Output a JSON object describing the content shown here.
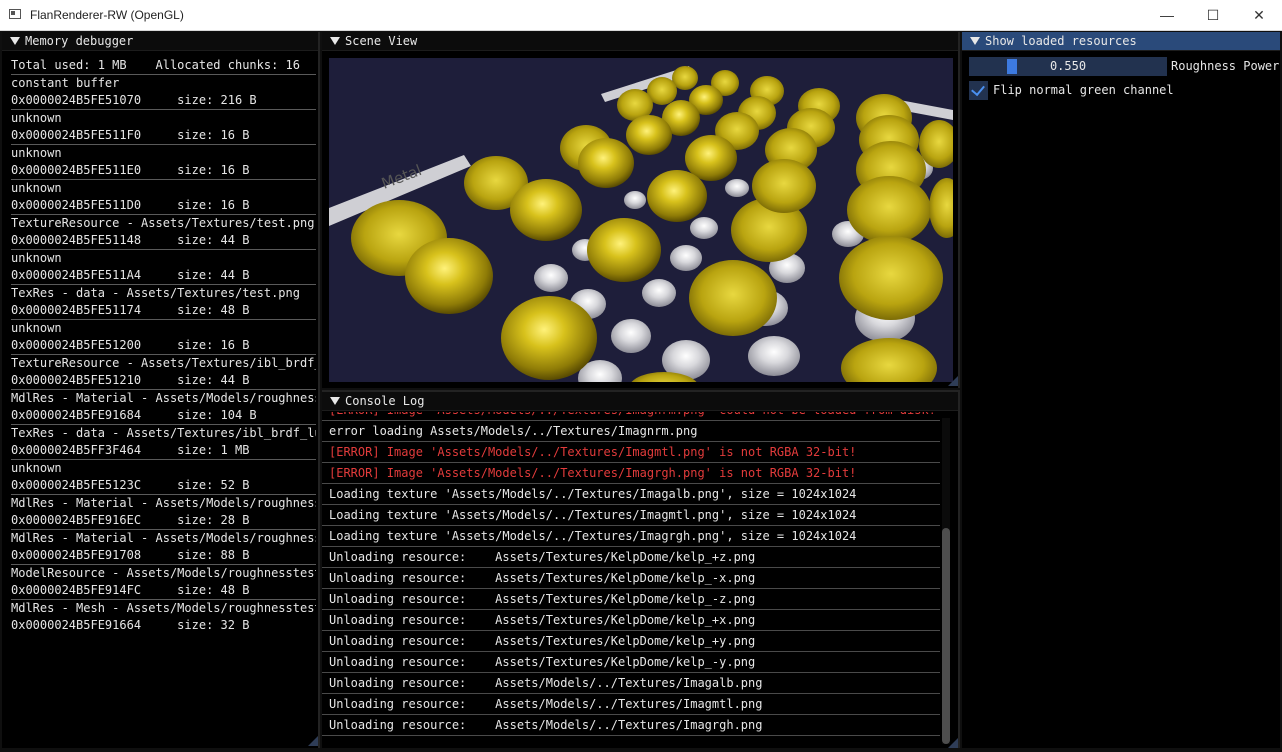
{
  "window": {
    "title": "FlanRenderer-RW (OpenGL)",
    "minimize_glyph": "—",
    "maximize_glyph": "☐",
    "close_glyph": "✕"
  },
  "memory_debugger": {
    "title": "Memory debugger",
    "total": "Total used: 1 MB    Allocated chunks: 16",
    "entries": [
      {
        "name": "constant buffer",
        "detail": "0x0000024B5FE51070     size: 216 B"
      },
      {
        "name": "unknown",
        "detail": "0x0000024B5FE511F0     size: 16 B"
      },
      {
        "name": "unknown",
        "detail": "0x0000024B5FE511E0     size: 16 B"
      },
      {
        "name": "unknown",
        "detail": "0x0000024B5FE511D0     size: 16 B"
      },
      {
        "name": "TextureResource - Assets/Textures/test.png",
        "detail": "0x0000024B5FE51148     size: 44 B"
      },
      {
        "name": "unknown",
        "detail": "0x0000024B5FE511A4     size: 44 B"
      },
      {
        "name": "TexRes - data - Assets/Textures/test.png",
        "detail": "0x0000024B5FE51174     size: 48 B"
      },
      {
        "name": "unknown",
        "detail": "0x0000024B5FE51200     size: 16 B"
      },
      {
        "name": "TextureResource - Assets/Textures/ibl_brdf_",
        "detail": "0x0000024B5FE51210     size: 44 B"
      },
      {
        "name": "MdlRes - Material - Assets/Models/roughness",
        "detail": "0x0000024B5FE91684     size: 104 B"
      },
      {
        "name": "TexRes - data - Assets/Textures/ibl_brdf_lu",
        "detail": "0x0000024B5FF3F464     size: 1 MB"
      },
      {
        "name": "unknown",
        "detail": "0x0000024B5FE5123C     size: 52 B"
      },
      {
        "name": "MdlRes - Material - Assets/Models/roughness",
        "detail": "0x0000024B5FE916EC     size: 28 B"
      },
      {
        "name": "MdlRes - Material - Assets/Models/roughness",
        "detail": "0x0000024B5FE91708     size: 88 B"
      },
      {
        "name": "ModelResource - Assets/Models/roughnesstest.",
        "detail": "0x0000024B5FE914FC     size: 48 B"
      },
      {
        "name": "MdlRes - Mesh - Assets/Models/roughnesstest.",
        "detail": "0x0000024B5FE91664     size: 32 B"
      }
    ]
  },
  "scene_view": {
    "title": "Scene View",
    "sign_label": "Metal",
    "background_color": "#1e1e3a",
    "gold_color": "#c9b516",
    "silver_color": "#d9d9dc"
  },
  "console_log": {
    "title": "Console Log",
    "lines": [
      {
        "text": "[ERROR] Image 'Assets/Models/../Textures/Imagnrm.png' could not be loaded from disk!",
        "error": true
      },
      {
        "text": "error loading Assets/Models/../Textures/Imagnrm.png",
        "error": false
      },
      {
        "text": "[ERROR] Image 'Assets/Models/../Textures/Imagmtl.png' is not RGBA 32-bit!",
        "error": true
      },
      {
        "text": "[ERROR] Image 'Assets/Models/../Textures/Imagrgh.png' is not RGBA 32-bit!",
        "error": true
      },
      {
        "text": "Loading texture 'Assets/Models/../Textures/Imagalb.png', size = 1024x1024",
        "error": false
      },
      {
        "text": "Loading texture 'Assets/Models/../Textures/Imagmtl.png', size = 1024x1024",
        "error": false
      },
      {
        "text": "Loading texture 'Assets/Models/../Textures/Imagrgh.png', size = 1024x1024",
        "error": false
      },
      {
        "text": "Unloading resource:    Assets/Textures/KelpDome/kelp_+z.png",
        "error": false
      },
      {
        "text": "Unloading resource:    Assets/Textures/KelpDome/kelp_-x.png",
        "error": false
      },
      {
        "text": "Unloading resource:    Assets/Textures/KelpDome/kelp_-z.png",
        "error": false
      },
      {
        "text": "Unloading resource:    Assets/Textures/KelpDome/kelp_+x.png",
        "error": false
      },
      {
        "text": "Unloading resource:    Assets/Textures/KelpDome/kelp_+y.png",
        "error": false
      },
      {
        "text": "Unloading resource:    Assets/Textures/KelpDome/kelp_-y.png",
        "error": false
      },
      {
        "text": "Unloading resource:    Assets/Models/../Textures/Imagalb.png",
        "error": false
      },
      {
        "text": "Unloading resource:    Assets/Models/../Textures/Imagmtl.png",
        "error": false
      },
      {
        "text": "Unloading resource:    Assets/Models/../Textures/Imagrgh.png",
        "error": false
      }
    ]
  },
  "resources_panel": {
    "title": "Show loaded resources",
    "roughness_value": "0.550",
    "roughness_fraction": 0.2,
    "roughness_label": "Roughness Power",
    "flip_label": "Flip normal green channel",
    "flip_checked": true
  }
}
